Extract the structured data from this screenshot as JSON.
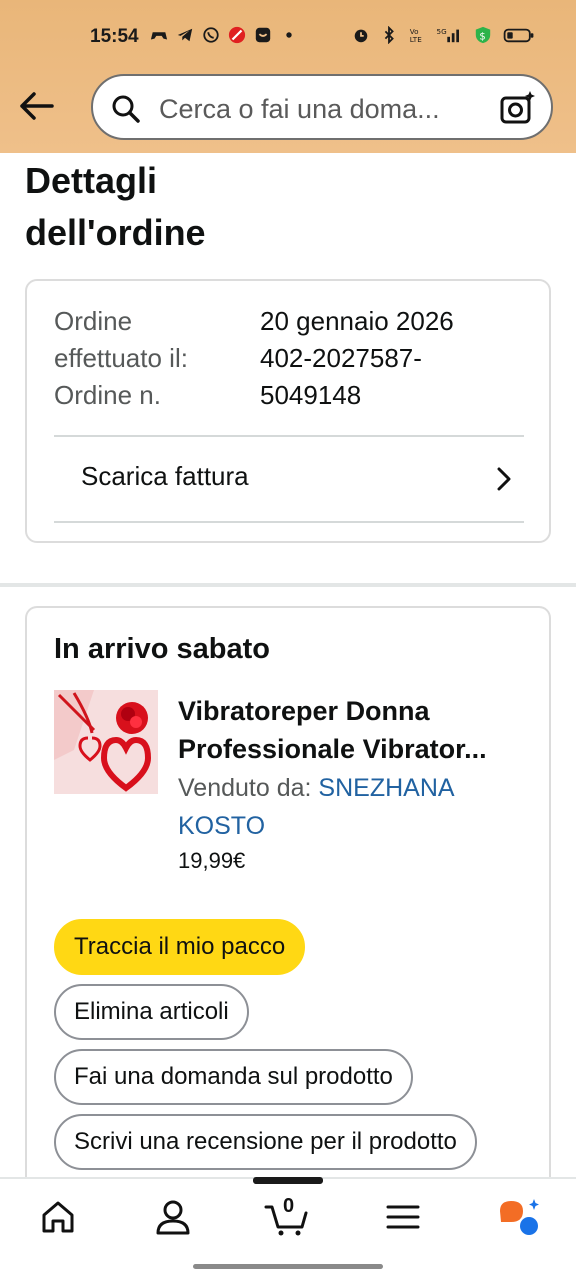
{
  "status": {
    "time": "15:54",
    "network": "5G"
  },
  "search": {
    "placeholder": "Cerca o fai una doma..."
  },
  "page": {
    "title_line1": "Dettagli",
    "title_line2": "dell'ordine"
  },
  "order": {
    "placed_label_1": "Ordine",
    "placed_label_2": "effettuato il:",
    "number_label": "Ordine n.",
    "date": "20 gennaio 2026",
    "number_line1": "402-2027587-",
    "number_line2": "5049148",
    "invoice_label": "Scarica fattura"
  },
  "delivery": {
    "heading": "In arrivo sabato",
    "product_name_line1": "Vibratoreper Donna",
    "product_name_line2": "Professionale Vibrator...",
    "sold_by_label": "Venduto da:",
    "seller_line1": "SNEZHANA",
    "seller_line2": "KOSTO",
    "price": "19,99€"
  },
  "buttons": {
    "track": "Traccia il mio pacco",
    "delete": "Elimina articoli",
    "ask": "Fai una domanda sul prodotto",
    "review": "Scrivi una recensione per il prodotto"
  },
  "nav": {
    "cart_count": "0"
  },
  "colors": {
    "header": "#efc08a",
    "primary_button": "#ffd814",
    "link": "#2162a1",
    "rufus_orange": "#f36d25",
    "rufus_blue": "#1a73e8"
  }
}
